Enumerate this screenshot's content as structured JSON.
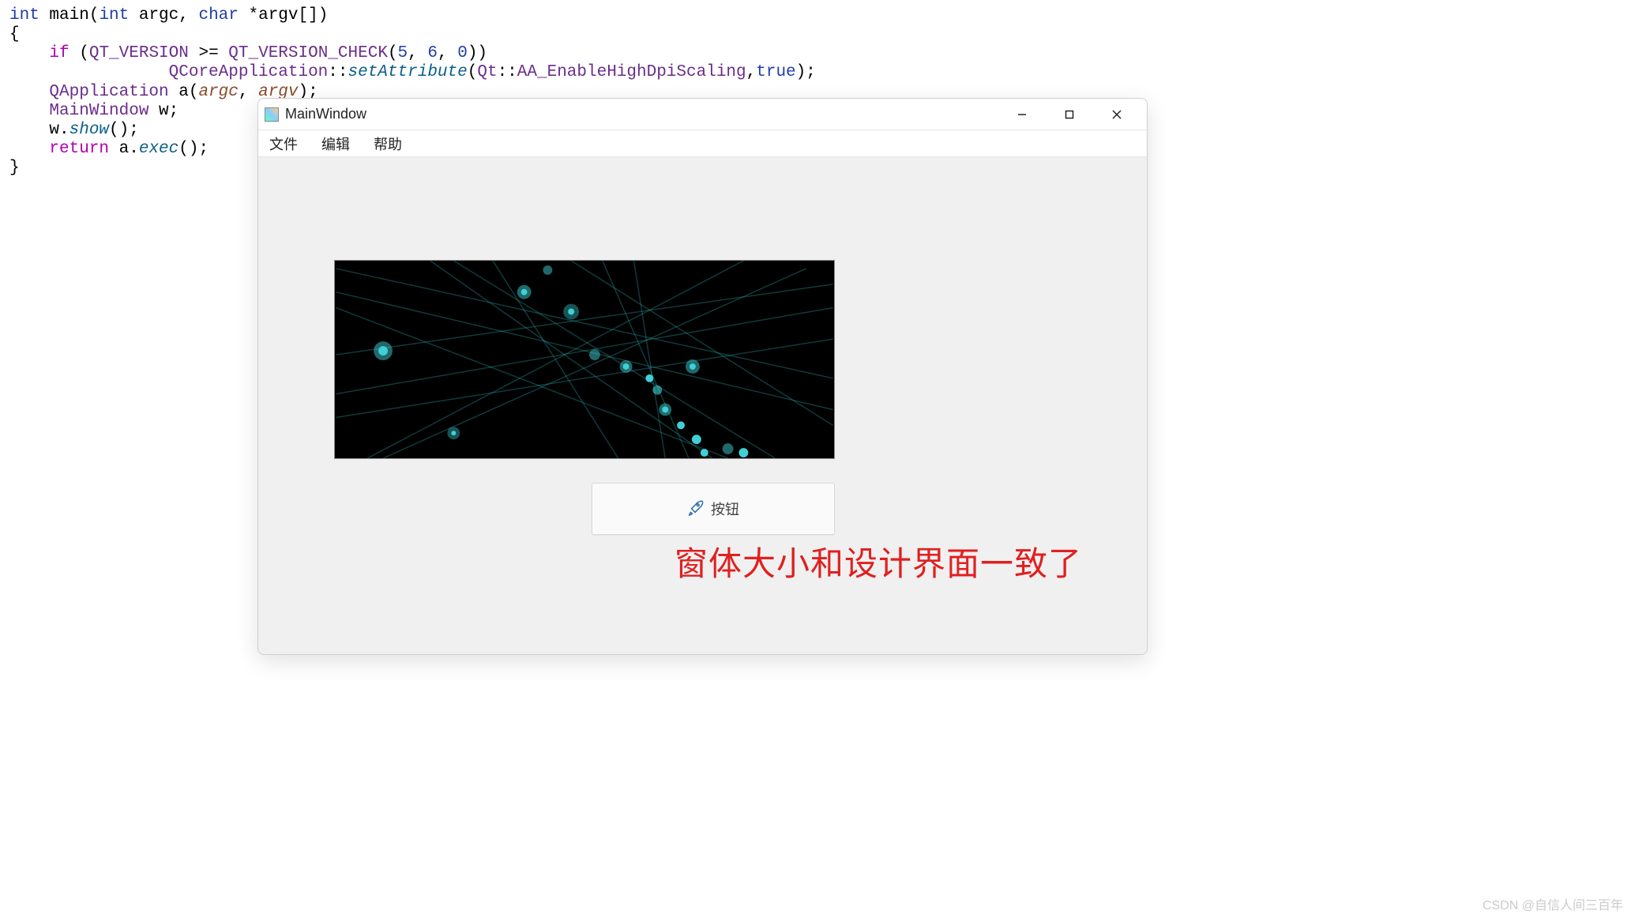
{
  "code": {
    "line1_int": "int",
    "line1_main": " main(",
    "line1_int2": "int",
    "line1_argc": " argc, ",
    "line1_char": "char",
    "line1_argv": " *argv[])",
    "line2": "{",
    "line3_if": "    if",
    "line3_open": " (",
    "line3_qtver": "QT_VERSION",
    "line3_gte": " >= ",
    "line3_check": "QT_VERSION_CHECK",
    "line3_args": "(",
    "line3_n1": "5",
    "line3_c1": ", ",
    "line3_n2": "6",
    "line3_c2": ", ",
    "line3_n3": "0",
    "line3_close": "))",
    "line4_ind": "                ",
    "line4_class": "QCoreApplication",
    "line4_dcolon": "::",
    "line4_method": "setAttribute",
    "line4_open": "(",
    "line4_qt": "Qt",
    "line4_dcolon2": "::",
    "line4_enum": "AA_EnableHighDpiScaling",
    "line4_comma": ",",
    "line4_true": "true",
    "line4_close": ");",
    "line5_class": "    QApplication",
    "line5_a": " a(",
    "line5_argc": "argc",
    "line5_comma": ", ",
    "line5_argv": "argv",
    "line5_close": ");",
    "line6_class": "    MainWindow",
    "line6_rest": " w;",
    "line7_w": "    w.",
    "line7_show": "show",
    "line7_p": "();",
    "line8_ret": "    return",
    "line8_a": " a.",
    "line8_exec": "exec",
    "line8_p": "();",
    "line9": "}"
  },
  "window": {
    "title": "MainWindow",
    "menu": {
      "file": "文件",
      "edit": "编辑",
      "help": "帮助"
    },
    "button": {
      "label": "按钮",
      "icon": "rocket-icon"
    }
  },
  "annotation": "窗体大小和设计界面一致了",
  "watermark": "CSDN @自信人间三百年"
}
